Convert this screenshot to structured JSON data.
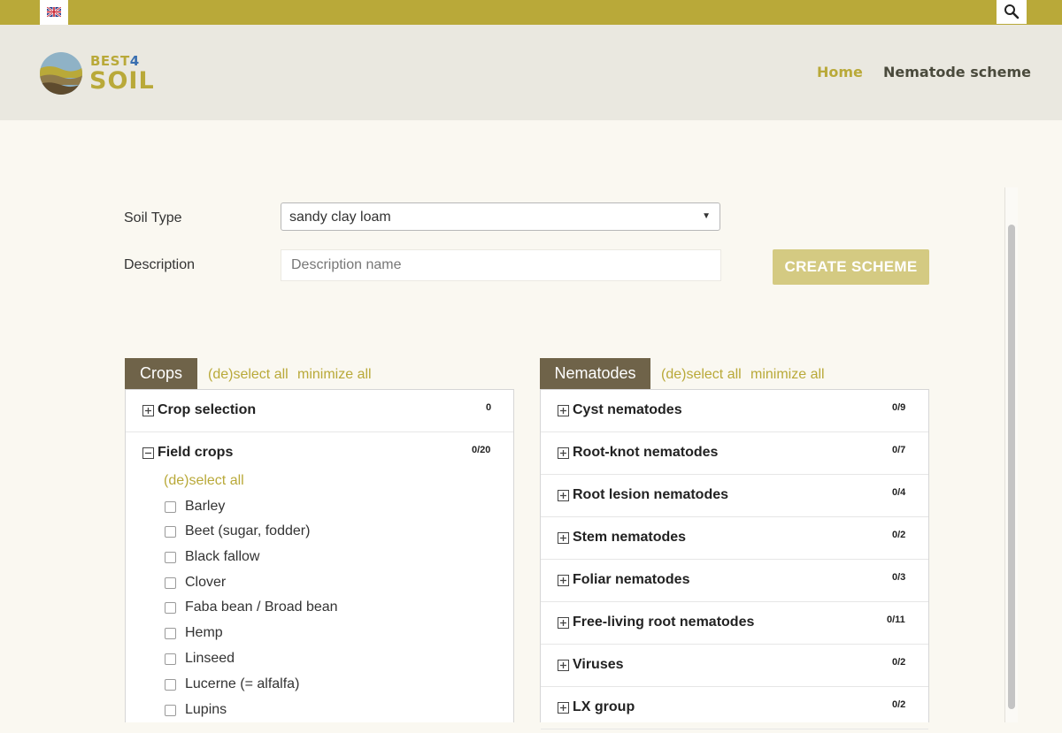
{
  "topbar": {
    "language_icon": "uk-flag-icon",
    "search_icon": "search-icon"
  },
  "header": {
    "logo": {
      "line1": "BEST",
      "line1_num": "4",
      "line2": "SOIL"
    },
    "nav": {
      "home": "Home",
      "scheme": "Nematode scheme"
    }
  },
  "form": {
    "soil_type_label": "Soil Type",
    "soil_type_value": "sandy clay loam",
    "description_label": "Description",
    "description_placeholder": "Description name",
    "create_button": "CREATE SCHEME"
  },
  "crops": {
    "tab": "Crops",
    "deselect_all": "(de)select all",
    "minimize_all": "minimize all",
    "groups": [
      {
        "title": "Crop selection",
        "count": "0",
        "expanded": false
      },
      {
        "title": "Field crops",
        "count": "0/20",
        "expanded": true
      }
    ],
    "field_crops_deselect": "(de)select all",
    "items": [
      "Barley",
      "Beet (sugar, fodder)",
      "Black fallow",
      "Clover",
      "Faba bean / Broad bean",
      "Hemp",
      "Linseed",
      "Lucerne (= alfalfa)",
      "Lupins"
    ]
  },
  "nematodes": {
    "tab": "Nematodes",
    "deselect_all": "(de)select all",
    "minimize_all": "minimize all",
    "groups": [
      {
        "title": "Cyst nematodes",
        "count": "0/9"
      },
      {
        "title": "Root-knot nematodes",
        "count": "0/7"
      },
      {
        "title": "Root lesion nematodes",
        "count": "0/4"
      },
      {
        "title": "Stem nematodes",
        "count": "0/2"
      },
      {
        "title": "Foliar nematodes",
        "count": "0/3"
      },
      {
        "title": "Free-living root nematodes",
        "count": "0/11"
      },
      {
        "title": "Viruses",
        "count": "0/2"
      },
      {
        "title": "LX group",
        "count": "0/2"
      }
    ]
  },
  "colors": {
    "accent": "#b9a939",
    "tab_bg": "#6f6349",
    "button_bg": "#d4ca82"
  }
}
